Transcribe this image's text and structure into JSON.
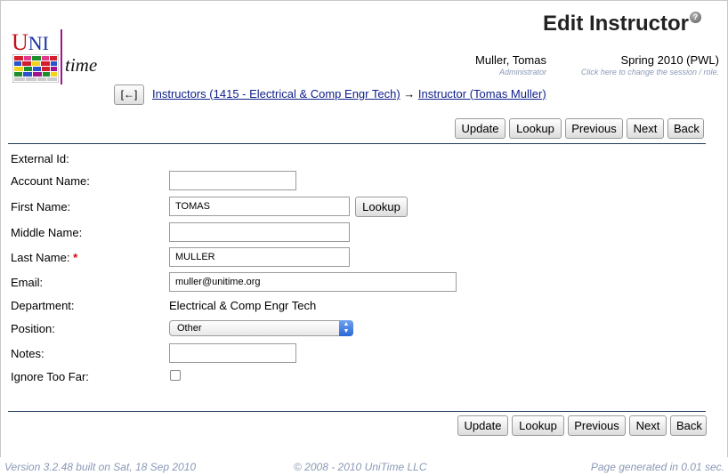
{
  "header": {
    "title": "Edit Instructor",
    "help_icon": "?",
    "logo": {
      "uni": "UNI",
      "time": "time"
    },
    "user": {
      "name": "Muller, Tomas",
      "role": "Administrator"
    },
    "session": {
      "name": "Spring 2010 (PWL)",
      "hint": "Click here to change the session / role."
    }
  },
  "breadcrumb": {
    "back_label": "[←]",
    "items": [
      "Instructors (1415 - Electrical & Comp Engr Tech)",
      "Instructor (Tomas Muller)"
    ],
    "separator": "→"
  },
  "buttons": {
    "update": "Update",
    "lookup": "Lookup",
    "previous": "Previous",
    "next": "Next",
    "back": "Back"
  },
  "form": {
    "external_id": {
      "label": "External Id:",
      "value": ""
    },
    "account_name": {
      "label": "Account Name:",
      "value": ""
    },
    "first_name": {
      "label": "First Name:",
      "value": "TOMAS",
      "lookup": "Lookup"
    },
    "middle_name": {
      "label": "Middle Name:",
      "value": ""
    },
    "last_name": {
      "label": "Last Name:",
      "required_mark": "*",
      "value": "MULLER"
    },
    "email": {
      "label": "Email:",
      "value": "muller@unitime.org"
    },
    "department": {
      "label": "Department:",
      "value": "Electrical & Comp Engr Tech"
    },
    "position": {
      "label": "Position:",
      "value": "Other"
    },
    "notes": {
      "label": "Notes:",
      "value": ""
    },
    "ignore_too_far": {
      "label": "Ignore Too Far:",
      "checked": false
    }
  },
  "footer": {
    "version": "Version 3.2.48 built on Sat, 18 Sep 2010",
    "copyright": "© 2008 - 2010 UniTime LLC",
    "generated": "Page generated in 0.01 sec."
  },
  "colors": {
    "link": "#10208a",
    "muted": "#8a99b6",
    "rule": "#1f3a5a",
    "required": "#dd0000"
  }
}
